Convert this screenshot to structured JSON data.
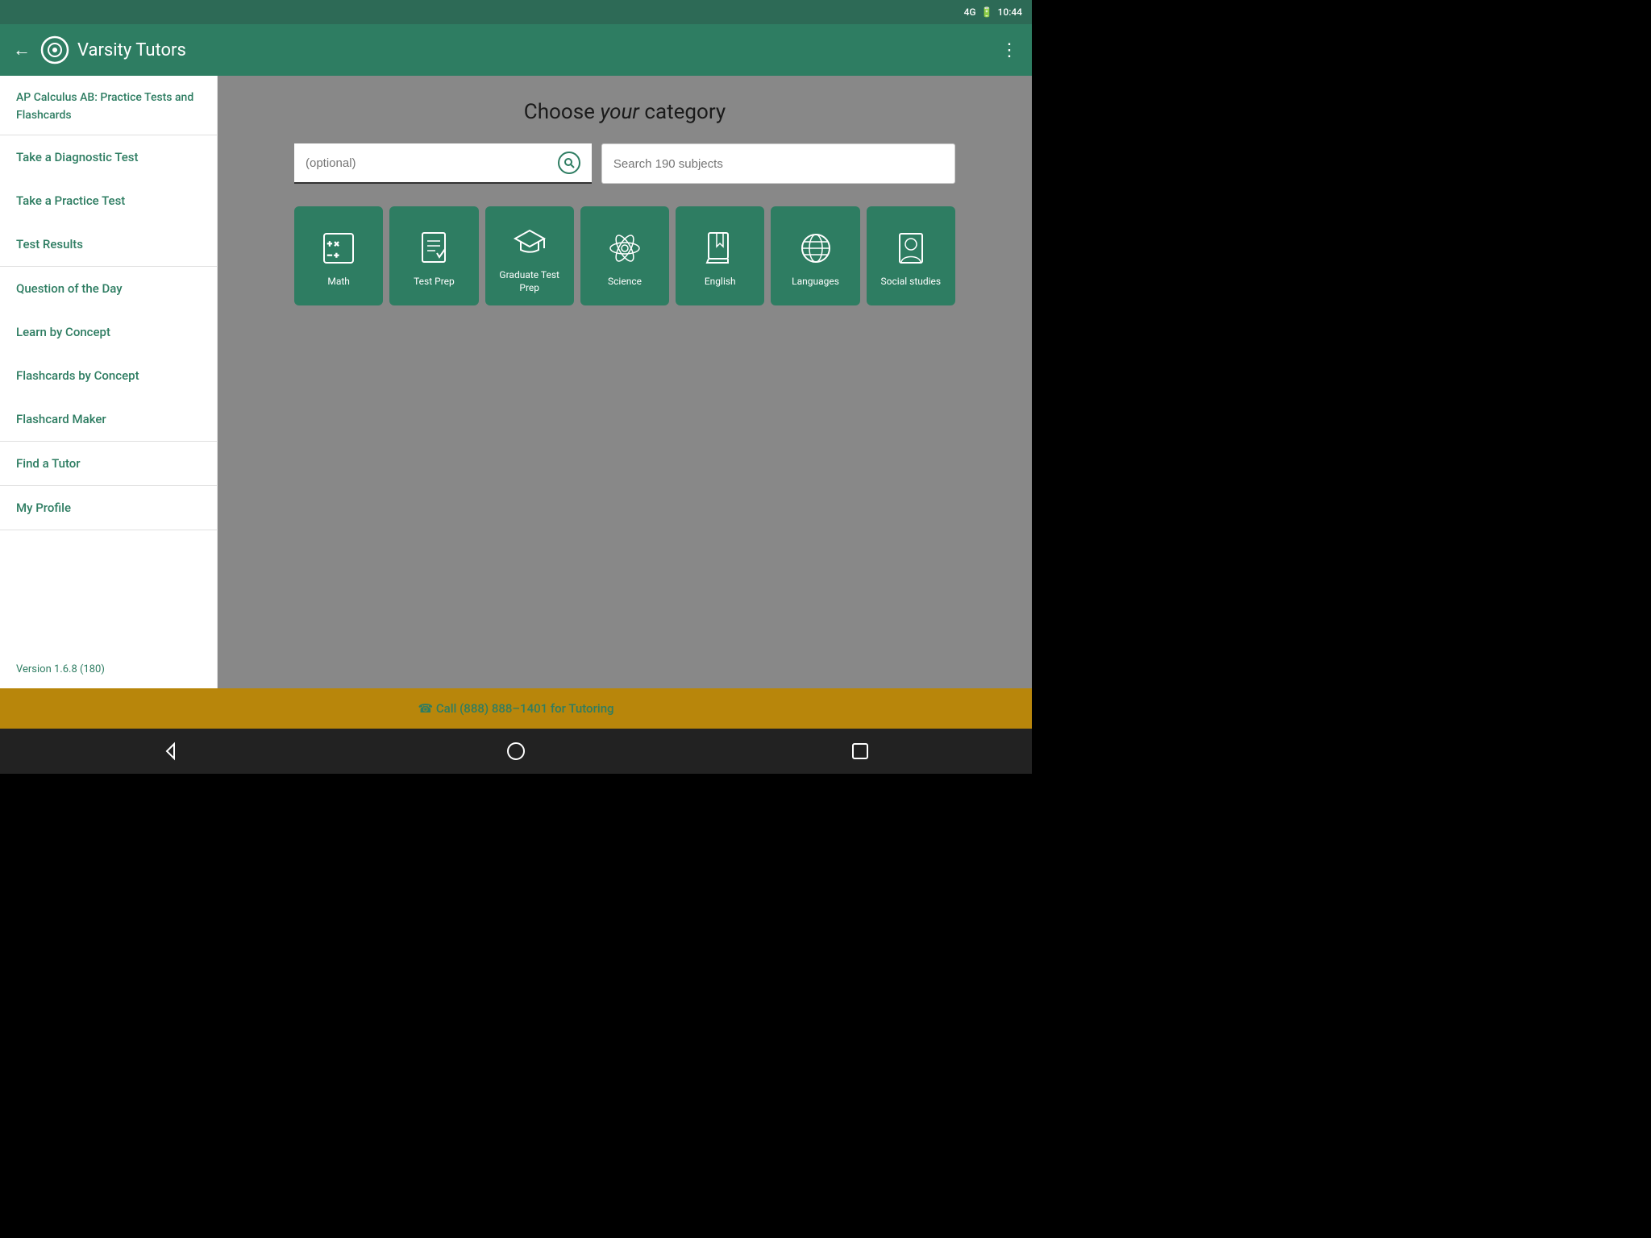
{
  "statusBar": {
    "network": "4G",
    "time": "10:44"
  },
  "appBar": {
    "title": "Varsity Tutors",
    "backLabel": "←",
    "moreLabel": "⋮"
  },
  "sidebar": {
    "headerText": "AP Calculus AB: Practice Tests and Flashcards",
    "groups": [
      {
        "items": [
          {
            "label": "Take a Diagnostic Test"
          },
          {
            "label": "Take a Practice Test"
          },
          {
            "label": "Test Results"
          }
        ]
      },
      {
        "items": [
          {
            "label": "Question of the Day"
          },
          {
            "label": "Learn by Concept"
          },
          {
            "label": "Flashcards by Concept"
          },
          {
            "label": "Flashcard Maker"
          }
        ]
      },
      {
        "items": [
          {
            "label": "Find a Tutor"
          }
        ]
      },
      {
        "items": [
          {
            "label": "My Profile"
          }
        ]
      }
    ],
    "version": "Version 1.6.8 (180)"
  },
  "content": {
    "title": "Choose ",
    "titleItalic": "your",
    "titleSuffix": " category",
    "searchOptionalPlaceholder": "(optional)",
    "searchSubjectsPlaceholder": "Search 190 subjects",
    "cards": [
      {
        "label": "Math",
        "icon": "calculator"
      },
      {
        "label": "Test Prep",
        "icon": "checklist"
      },
      {
        "label": "Graduate Test Prep",
        "icon": "graduation"
      },
      {
        "label": "Science",
        "icon": "atom"
      },
      {
        "label": "English",
        "icon": "book"
      },
      {
        "label": "Languages",
        "icon": "globe"
      },
      {
        "label": "Social studies",
        "icon": "person-card"
      }
    ]
  },
  "callBar": {
    "text": "☎ Call (888) 888–1401 for Tutoring"
  }
}
